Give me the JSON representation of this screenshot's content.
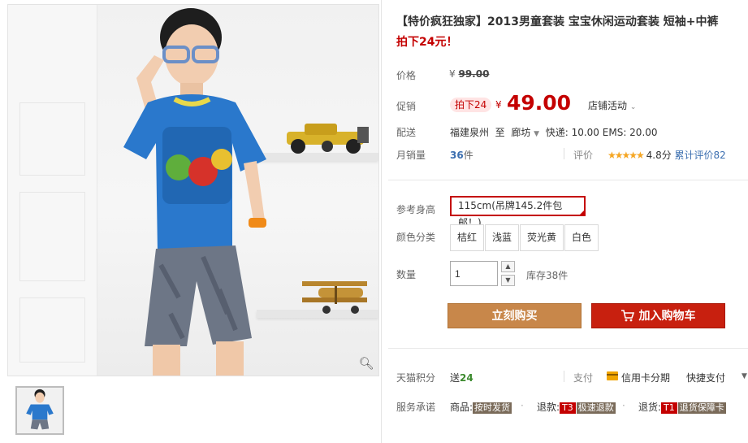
{
  "product": {
    "title": "【特价疯狂独家】2013男童套装 宝宝休闲运动套装 短袖+中裤",
    "subtitle": "拍下24元！"
  },
  "price": {
    "label": "价格",
    "currency": "¥",
    "original": "99.00"
  },
  "promo": {
    "label": "促销",
    "badge": "拍下24",
    "currency": "¥",
    "price": "49.00",
    "shop_promo": "店铺活动"
  },
  "shipping": {
    "label": "配送",
    "from": "福建泉州",
    "to_word": "至",
    "to": "廊坊",
    "fee": "快递: 10.00 EMS: 20.00"
  },
  "sales": {
    "label": "月销量",
    "count": "36",
    "unit": "件",
    "rating_label": "评价",
    "stars": "★★★★★",
    "score": "4.8分",
    "review_link": "累计评价82"
  },
  "size": {
    "label": "参考身高",
    "selected": "115cm(吊牌145.2件包邮！)"
  },
  "color": {
    "label": "颜色分类",
    "options": [
      "桔红",
      "浅蓝",
      "荧光黄",
      "白色"
    ]
  },
  "quantity": {
    "label": "数量",
    "value": "1",
    "stock": "库存38件"
  },
  "buttons": {
    "buy": "立刻购买",
    "cart": "加入购物车"
  },
  "points": {
    "label": "天猫积分",
    "text": "送",
    "value": "24"
  },
  "payment": {
    "label": "支付",
    "credit": "信用卡分期",
    "quick": "快捷支付"
  },
  "service": {
    "label": "服务承诺",
    "items": [
      {
        "prefix": "商品:",
        "tag": "按时发货"
      },
      {
        "prefix": "退款:",
        "badge": "T3",
        "tag": "极速退款"
      },
      {
        "prefix": "退货:",
        "badge": "T1",
        "tag": "退货保障卡"
      }
    ]
  },
  "colors": {
    "accent_red": "#c40000",
    "buy_button": "#c8874a",
    "cart_button": "#c8200f",
    "link_blue": "#3c6fb0",
    "star": "#f5a623"
  },
  "icons": [
    "zoom-icon",
    "chevron-down-icon",
    "cart-icon",
    "credit-card-icon",
    "caret-down-icon"
  ]
}
